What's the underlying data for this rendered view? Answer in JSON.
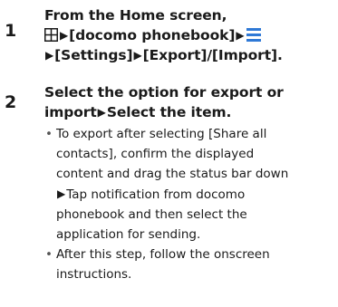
{
  "steps": [
    {
      "number": "1",
      "lines": [
        "From the Home screen,",
        "[docomo phonebook]",
        "[Settings]",
        "[Export]/[Import]."
      ]
    },
    {
      "number": "2",
      "title_line1": "Select the option for export or",
      "title_line2a": "import",
      "title_line2b": "Select the item.",
      "bullets": [
        {
          "line1": "To export after selecting [Share all",
          "line2": "contacts], confirm the displayed",
          "line3": "content and drag the status bar down",
          "line4": "Tap notification from docomo",
          "line5": "phonebook and then select the",
          "line6": "application for sending."
        },
        {
          "line1": "After this step, follow the onscreen",
          "line2": "instructions."
        }
      ]
    }
  ],
  "colors": {
    "text": "#1a1a1a",
    "menu_icon": "#2f79d6",
    "apps_icon": "#1a1a1a"
  },
  "icons": {
    "apps": "apps-grid-icon",
    "menu": "menu-lines-icon",
    "arrow": "right-triangle-arrow"
  }
}
